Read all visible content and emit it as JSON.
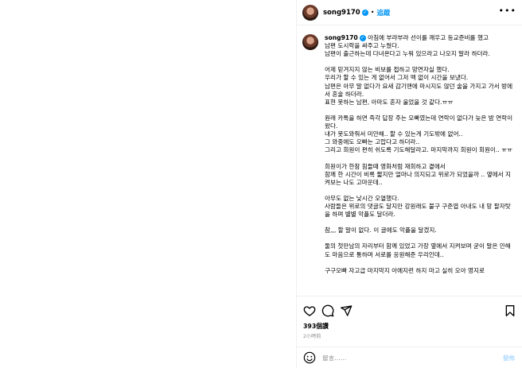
{
  "post": {
    "username": "song9170",
    "follow_label": "追蹤",
    "more_label": "•••"
  },
  "caption": {
    "username": "song9170",
    "lines": [
      "아침에 부랴부랴 선이를 깨우고 등교준비를 했고",
      "남편 도시락을 싸주고 누웠다.",
      "남편이 출근하는데 다녀온다고 누워 있으라고 나오지 말라 하더라.",
      "",
      "어제 믿겨지지 않는 비보를 접하고 망연자실 했다.",
      "우리가 할 수 있는 게 없어서 그저 멕 없이 시간을 보냈다.",
      "남편은 아무 말 없다가 요새 감기맨에 마시지도 않던 술을 가지고 가서 방에서 혼술 하더라.",
      "표현 못하는 남편, 아마도 혼자 울었을 것 같다.ㅠㅠ",
      "",
      "원래 카톡을 하면 즉각 답장 주는 오빠였는데 연락이 없다가 늦은 밤 연락이 왔다.",
      "내가 못도와줘서 미안해.. 할 수 있는게 기도밖에 없어..",
      "그 와중에도 오빠는 고맙다고 하더라..",
      "그리고 회원이 편히 쉬도록 기도해달라고. 마지막까지 회원이 회원이.. ㅠㅠ",
      "",
      "희원이가 한참 힘들때 영화처럼 재회하고 곁에서",
      "함께 한 시간이 비록 짧지만 얼마나 의지되고 위로가 되었을까 .. 옆에서 지켜보는 나도 고마운데..",
      "",
      "아무도 없는 낮시간 오열했다.",
      "사람들은 위로의 댓글도 달지만 강원래도 불구 구준엽 아내도 내 망 팔자탓을 하며 별별 악플도 달더라.",
      "",
      "참,,, 할 말이 없다. 이 글에도 악플을 달겠지.",
      "",
      "둘의 첫만남의 자리부터 함께 있었고 가장 옆에서 지켜보며 굳이 말은 안해도 마음으로 통하며 서로를 응원해준 우리인데..",
      "",
      "구구오빠 자고급 마지막지 아에지런 하지 마고 실히 오아 영지로"
    ]
  },
  "stats": {
    "likes": "393個讚",
    "time": "2小時前"
  },
  "comment_box": {
    "placeholder": "留言……",
    "post_label": "發佈"
  }
}
